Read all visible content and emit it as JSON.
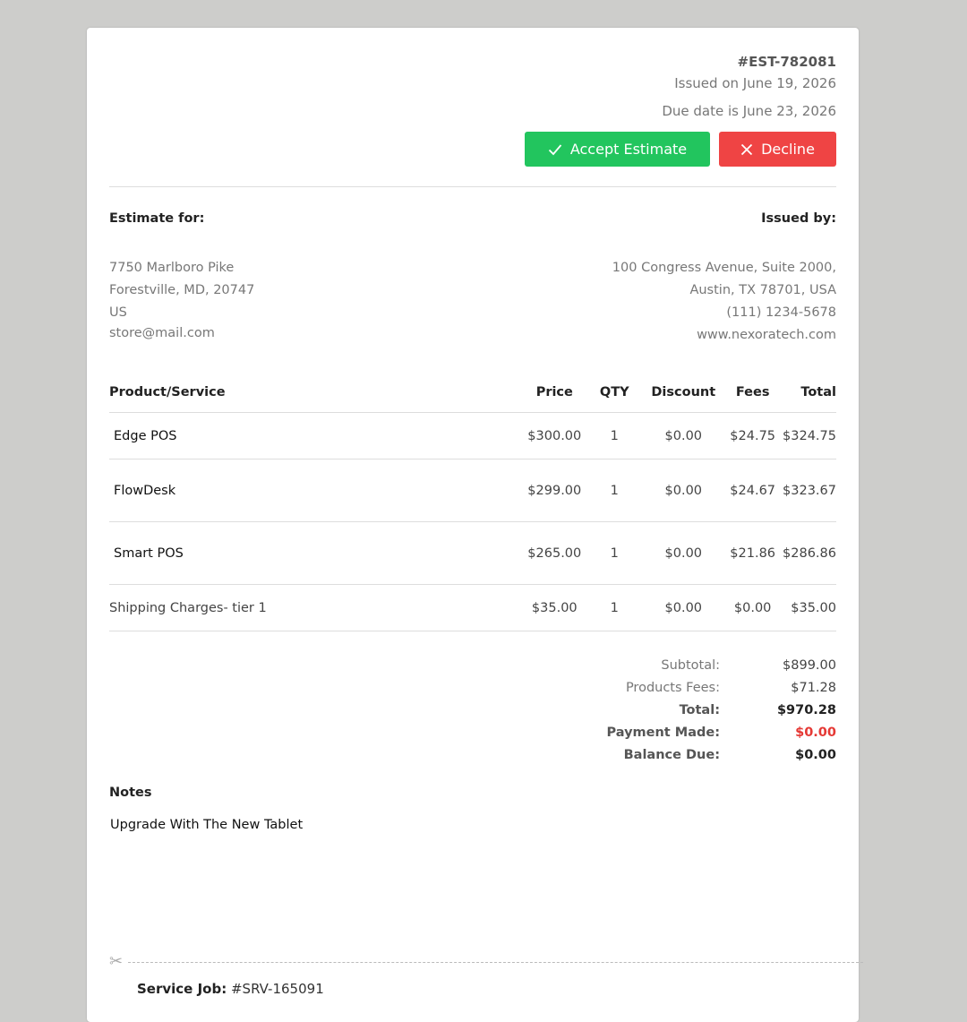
{
  "header": {
    "estimate_number": "#EST-782081",
    "issued_on": "Issued on June 19, 2026",
    "due_date": "Due date is June 23, 2026"
  },
  "actions": {
    "accept_label": "Accept Estimate",
    "decline_label": "Decline",
    "accept_color": "#22c55e",
    "decline_color": "#ef4444"
  },
  "estimate_for": {
    "label": "Estimate for:",
    "lines": [
      "7750 Marlboro Pike",
      "Forestville, MD, 20747",
      "US",
      "store@mail.com"
    ]
  },
  "issued_by": {
    "label": "Issued by:",
    "lines": [
      "100 Congress Avenue, Suite 2000,",
      "Austin, TX 78701, USA",
      "(111) 1234-5678",
      "www.nexoratech.com"
    ]
  },
  "table": {
    "headers": [
      "Product/Service",
      "Price",
      "QTY",
      "Discount",
      "Fees",
      "Total"
    ],
    "rows": [
      {
        "name": "Edge POS",
        "price": "$300.00",
        "qty": "1",
        "discount": "$0.00",
        "fees": "$24.75",
        "total": "$324.75"
      },
      {
        "name": "FlowDesk",
        "price": "$299.00",
        "qty": "1",
        "discount": "$0.00",
        "fees": "$24.67",
        "total": "$323.67"
      },
      {
        "name": "Smart POS",
        "price": "$265.00",
        "qty": "1",
        "discount": "$0.00",
        "fees": "$21.86",
        "total": "$286.86"
      },
      {
        "name": "Shipping Charges- tier 1",
        "price": "$35.00",
        "qty": "1",
        "discount": "$0.00",
        "fees": "$0.00",
        "total": "$35.00"
      }
    ]
  },
  "totals": {
    "subtotal_label": "Subtotal:",
    "subtotal_value": "$899.00",
    "fees_label": "Products Fees:",
    "fees_value": "$71.28",
    "total_label": "Total:",
    "total_value": "$970.28",
    "payment_label": "Payment Made:",
    "payment_value": "$0.00",
    "balance_label": "Balance Due:",
    "balance_value": "$0.00"
  },
  "notes": {
    "title": "Notes",
    "text": "Upgrade With The New Tablet"
  },
  "service_job": {
    "label": "Service Job:",
    "number": "#SRV-165091"
  }
}
